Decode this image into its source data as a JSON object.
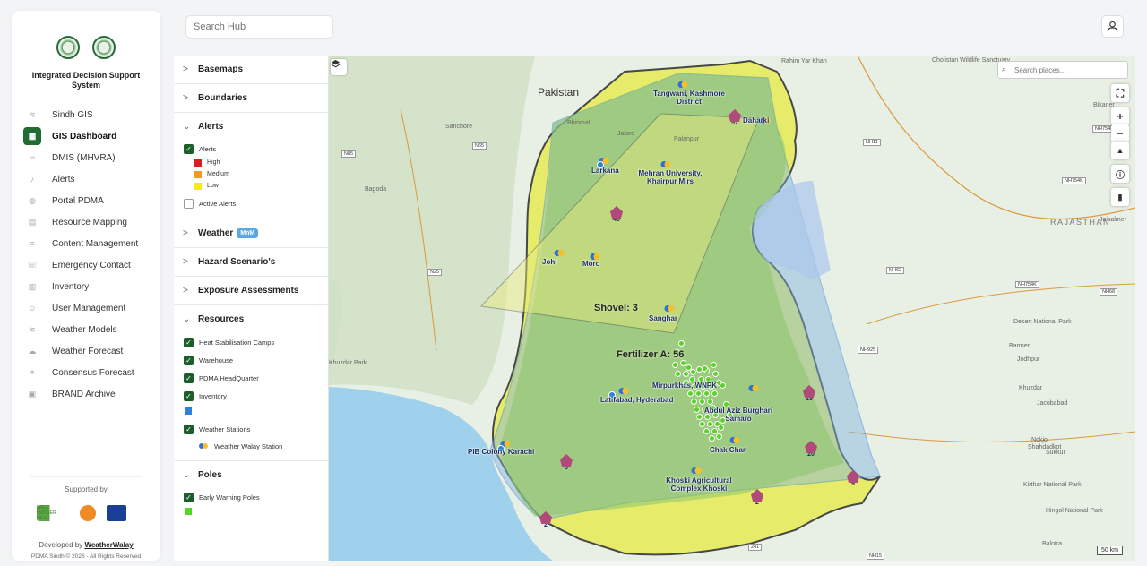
{
  "app": {
    "title": "Integrated Decision Support System"
  },
  "nav": {
    "items": [
      {
        "label": "Sindh GIS",
        "icon": "layers-icon"
      },
      {
        "label": "GIS Dashboard",
        "icon": "dashboard-icon",
        "active": true
      },
      {
        "label": "DMIS (MHVRA)",
        "icon": "link-icon"
      },
      {
        "label": "Alerts",
        "icon": "bell-icon"
      },
      {
        "label": "Portal PDMA",
        "icon": "globe-icon"
      },
      {
        "label": "Resource Mapping",
        "icon": "document-icon"
      },
      {
        "label": "Content Management",
        "icon": "content-icon"
      },
      {
        "label": "Emergency Contact",
        "icon": "phone-icon"
      },
      {
        "label": "Inventory",
        "icon": "inventory-icon"
      },
      {
        "label": "User Management",
        "icon": "users-icon"
      },
      {
        "label": "Weather Models",
        "icon": "layers-icon"
      },
      {
        "label": "Weather Forecast",
        "icon": "cloud-icon"
      },
      {
        "label": "Consensus Forecast",
        "icon": "sun-icon"
      },
      {
        "label": "BRAND Archive",
        "icon": "archive-icon"
      }
    ]
  },
  "footer": {
    "supported_by": "Supported by",
    "developed_by_prefix": "Developed by",
    "developer": "WeatherWalay",
    "copyright": "PDMA Sindh © 2026 - All Rights Reserved",
    "sponsor_1": "WELT HUNGER HILFE"
  },
  "topbar": {
    "search_placeholder": "Search Hub"
  },
  "panel": {
    "basemaps": "Basemaps",
    "boundaries": "Boundaries",
    "alerts": {
      "title": "Alerts",
      "layer": "Alerts",
      "legend": [
        {
          "label": "High",
          "color": "#d81e1e"
        },
        {
          "label": "Medium",
          "color": "#f29a1b"
        },
        {
          "label": "Low",
          "color": "#f5e81c"
        }
      ],
      "active_alerts": "Active Alerts"
    },
    "weather": {
      "title": "Weather",
      "badge": "MnM"
    },
    "hazard": "Hazard Scenario's",
    "exposure": "Exposure Assessments",
    "resources": {
      "title": "Resources",
      "layers": [
        "Heat Stabilisation Camps",
        "Warehouse",
        "PDMA HeadQuarter",
        "Inventory"
      ],
      "inventory_color": "#2f80d8",
      "weather_stations": "Weather Stations",
      "station_legend": "Weather Walay Station"
    },
    "poles": {
      "title": "Poles",
      "layer": "Early Warning Poles",
      "color": "#59d22a"
    }
  },
  "map": {
    "search_placeholder": "Search places...",
    "scale": "50 km",
    "country_label": "Pakistan",
    "state_label": "RAJASTHAN",
    "zones": [
      "Shovel: 3",
      "Fertilizer A: 56"
    ],
    "places": [
      {
        "name": "Tangwani, Kashmore District"
      },
      {
        "name": "Daharki"
      },
      {
        "name": "Larkana"
      },
      {
        "name": "Mehran University, Khairpur Mirs"
      },
      {
        "name": "Johi"
      },
      {
        "name": "Moro"
      },
      {
        "name": "Sanghar"
      },
      {
        "name": "Mirpurkhas, WNPK"
      },
      {
        "name": "Latifabad, Hyderabad"
      },
      {
        "name": "Abdul Aziz Burghari Samaro"
      },
      {
        "name": "Chak Char"
      },
      {
        "name": "PIB Colony Karachi"
      },
      {
        "name": "Khoski Agricultural Complex Khoski"
      }
    ],
    "geo_labels": [
      "Rahim Yar Khan",
      "Cholistan Wildlife Sanctuary",
      "Bikaner",
      "Jaisalmer",
      "Jodhpur",
      "Barmer",
      "Desert National Park",
      "Khuzdar",
      "Shahdadkot",
      "Nokjo",
      "Sukkur",
      "Jacobabad",
      "Kirthar National Park",
      "Hingol National Park",
      "Balotra",
      "Sanchore",
      "Bhinmal",
      "Bagoda",
      "Palanpur",
      "Jalore",
      "Khuzdar Park"
    ],
    "hotspots": [
      {
        "count": "57"
      },
      {
        "count": "40"
      },
      {
        "count": "15"
      },
      {
        "count": "20"
      },
      {
        "count": "9"
      },
      {
        "count": "5"
      },
      {
        "count": "2"
      },
      {
        "count": "2"
      }
    ],
    "road_labels": [
      "N65",
      "N85",
      "N25",
      "NH754K",
      "NH754K",
      "NH754K",
      "NH11",
      "NH62",
      "NH68",
      "NH925",
      "241",
      "NH15"
    ]
  }
}
